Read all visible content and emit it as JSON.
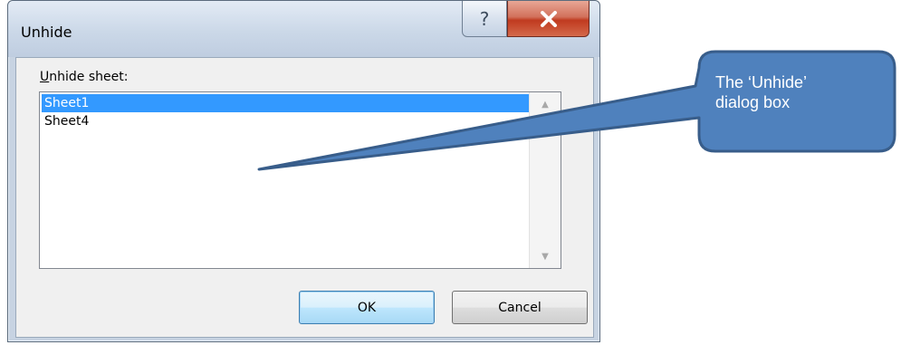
{
  "window": {
    "title": "Unhide",
    "help_glyph": "?",
    "icons": [
      "help-icon",
      "close-icon"
    ]
  },
  "dialog": {
    "label_accel": "U",
    "label_rest": "nhide sheet:",
    "items": [
      {
        "label": "Sheet1",
        "selected": true
      },
      {
        "label": "Sheet4",
        "selected": false
      }
    ],
    "scroll_up_glyph": "▲",
    "scroll_down_glyph": "▼",
    "ok_label": "OK",
    "cancel_label": "Cancel"
  },
  "callout": {
    "line1": "The ‘Unhide’",
    "line2": "dialog box",
    "fill": "#4f81bd",
    "stroke": "#385d8a"
  },
  "colors": {
    "selection": "#3399ff",
    "close_button": "#c03a1f",
    "frame": "#c7d3e2"
  }
}
